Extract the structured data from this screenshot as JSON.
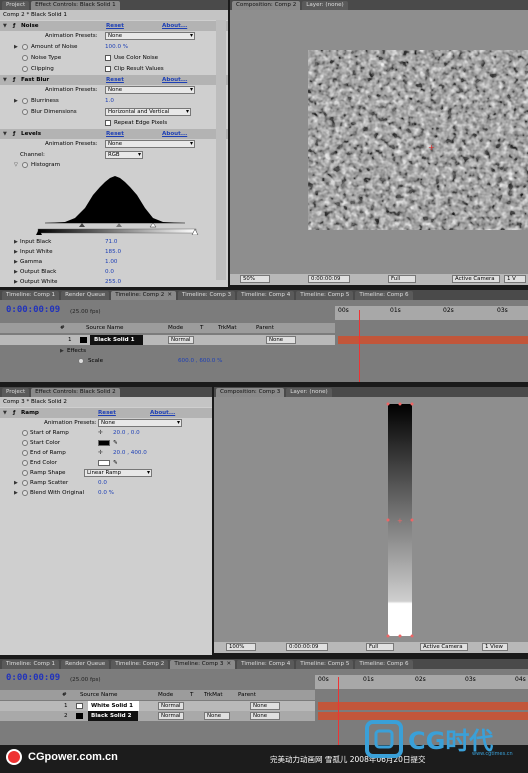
{
  "top": {
    "tabs": [
      {
        "label": "Project"
      },
      {
        "label": "Effect Controls: Black Solid 1"
      },
      {
        "label": "Composition: Comp 2"
      },
      {
        "label": "Layer: (none)"
      }
    ],
    "breadcrumb": "Comp 2 * Black Solid 1",
    "noise": {
      "name": "Noise",
      "reset": "Reset",
      "about": "About...",
      "presets_label": "Animation Presets:",
      "presets_value": "None",
      "amount_label": "Amount of Noise",
      "amount_value": "100.0 %",
      "type_label": "Noise Type",
      "type_check": "Use Color Noise",
      "clip_label": "Clipping",
      "clip_check": "Clip Result Values"
    },
    "blur": {
      "name": "Fast Blur",
      "reset": "Reset",
      "about": "About...",
      "presets_label": "Animation Presets:",
      "presets_value": "None",
      "blurriness_label": "Blurriness",
      "blurriness_value": "1.0",
      "dim_label": "Blur Dimensions",
      "dim_value": "Horizontal and Vertical",
      "repeat_check": "Repeat Edge Pixels"
    },
    "levels": {
      "name": "Levels",
      "reset": "Reset",
      "about": "About...",
      "presets_label": "Animation Presets:",
      "presets_value": "None",
      "channel_label": "Channel:",
      "channel_value": "RGB",
      "histogram_label": "Histogram",
      "input_black_label": "Input Black",
      "input_black_value": "71.0",
      "input_white_label": "Input White",
      "input_white_value": "185.0",
      "gamma_label": "Gamma",
      "gamma_value": "1.00",
      "output_black_label": "Output Black",
      "output_black_value": "0.0",
      "output_white_label": "Output White",
      "output_white_value": "255.0"
    },
    "viewer": {
      "zoom": "50%",
      "timecode": "0:00:00:09",
      "resolution": "Full",
      "camera": "Active Camera",
      "views": "1 V"
    }
  },
  "timeline1": {
    "tabs": [
      "Timeline: Comp 1",
      "Render Queue",
      "Timeline: Comp 2",
      "Timeline: Comp 3",
      "Timeline: Comp 4",
      "Timeline: Comp 5",
      "Timeline: Comp 6"
    ],
    "active_tab": "Timeline: Comp 2",
    "timecode": "0:00:00:09",
    "fps": "(25.00 fps)",
    "cols": {
      "num": "#",
      "source": "Source Name",
      "mode": "Mode",
      "t": "T",
      "trkmat": "TrkMat",
      "parent": "Parent"
    },
    "ruler": [
      "00s",
      "01s",
      "02s",
      "03s"
    ],
    "layer": {
      "num": "1",
      "name": "Black Solid 1",
      "mode": "Normal",
      "parent": "None"
    },
    "effects_label": "Effects",
    "scale_label": "Scale",
    "scale_value": "600.0 , 600.0 %"
  },
  "bottom": {
    "tabs": [
      {
        "label": "Project"
      },
      {
        "label": "Effect Controls: Black Solid 2"
      },
      {
        "label": "Composition: Comp 3"
      },
      {
        "label": "Layer: (none)"
      }
    ],
    "breadcrumb": "Comp 3 * Black Solid 2",
    "ramp": {
      "name": "Ramp",
      "reset": "Reset",
      "about": "About...",
      "presets_label": "Animation Presets:",
      "presets_value": "None",
      "start_label": "Start of Ramp",
      "start_value": "20.0 , 0.0",
      "start_color_label": "Start Color",
      "end_label": "End of Ramp",
      "end_value": "20.0 , 400.0",
      "end_color_label": "End Color",
      "shape_label": "Ramp Shape",
      "shape_value": "Linear Ramp",
      "scatter_label": "Ramp Scatter",
      "scatter_value": "0.0",
      "blend_label": "Blend With Original",
      "blend_value": "0.0 %"
    },
    "viewer": {
      "zoom": "100%",
      "timecode": "0:00:00:09",
      "resolution": "Full",
      "camera": "Active Camera",
      "views": "1 View"
    }
  },
  "timeline2": {
    "tabs": [
      "Timeline: Comp 1",
      "Render Queue",
      "Timeline: Comp 2",
      "Timeline: Comp 3",
      "Timeline: Comp 4",
      "Timeline: Comp 5",
      "Timeline: Comp 6"
    ],
    "active_tab": "Timeline: Comp 3",
    "timecode": "0:00:00:09",
    "fps": "(25.00 fps)",
    "cols": {
      "num": "#",
      "source": "Source Name",
      "mode": "Mode",
      "t": "T",
      "trkmat": "TrkMat",
      "parent": "Parent"
    },
    "ruler": [
      "00s",
      "01s",
      "02s",
      "03s",
      "04s"
    ],
    "layers": [
      {
        "num": "1",
        "name": "White Solid 1",
        "mode": "Normal",
        "trkmat": "",
        "parent": "None"
      },
      {
        "num": "2",
        "name": "Black Solid 2",
        "mode": "Normal",
        "trkmat": "None",
        "parent": "None"
      }
    ]
  },
  "footer": {
    "site": "CGpower.com.cn",
    "credit": "完美动力动画网 雪孤儿 2008年06月20日提交",
    "logo": "CG时代",
    "logo_url": "www.cgtimes.cn"
  },
  "colors": {
    "accent": "#1d3fb5",
    "layer_bar": "#c2563a",
    "panel": "#cfcfcf"
  }
}
